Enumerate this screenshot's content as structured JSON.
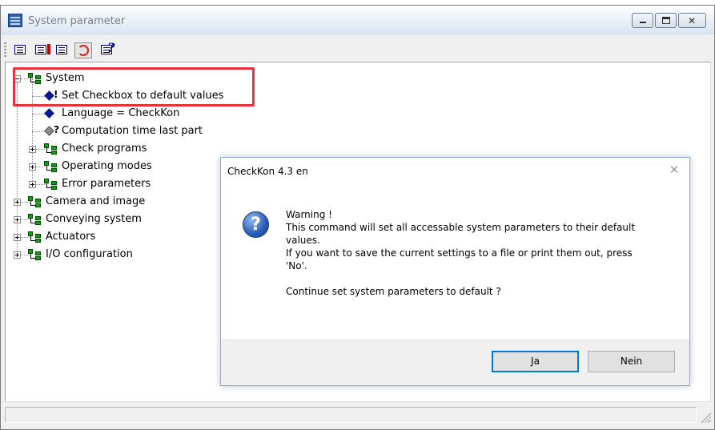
{
  "window": {
    "title": "System parameter",
    "icon": "app-grid-icon"
  },
  "toolbar": {
    "buttons": [
      {
        "name": "expand-all-icon"
      },
      {
        "name": "collapse-all-icon"
      },
      {
        "name": "find-icon"
      },
      {
        "name": "reset-default-icon",
        "pressed": true
      },
      {
        "name": "help-icon"
      }
    ]
  },
  "tree": {
    "nodes": [
      {
        "label": "System",
        "type": "folder",
        "expanded": true
      },
      {
        "label": "Set Checkbox to default values",
        "type": "param",
        "mark": "!"
      },
      {
        "label": "Language = CheckKon",
        "type": "param",
        "mark": ""
      },
      {
        "label": "Computation time last part",
        "type": "param-gray",
        "mark": "?"
      },
      {
        "label": "Check programs",
        "type": "folder",
        "expanded": false
      },
      {
        "label": "Operating modes",
        "type": "folder",
        "expanded": false
      },
      {
        "label": "Error parameters",
        "type": "folder",
        "expanded": false
      },
      {
        "label": "Camera and image",
        "type": "folder",
        "expanded": false
      },
      {
        "label": "Conveying system",
        "type": "folder",
        "expanded": false
      },
      {
        "label": "Actuators",
        "type": "folder",
        "expanded": false
      },
      {
        "label": "I/O configuration",
        "type": "folder",
        "expanded": false
      }
    ]
  },
  "dialog": {
    "title": "CheckKon 4.3 en",
    "close_glyph": "✕",
    "icon_glyph": "?",
    "message": {
      "line1": "Warning !",
      "line2": "This command will set all accessable system parameters to their default",
      "line3": "values.",
      "line4": "If you want to save the current settings to a file or print them out, press",
      "line5": "'No'.",
      "line6": "Continue set system parameters to default ?"
    },
    "buttons": {
      "yes": "Ja",
      "no": "Nein"
    }
  },
  "colors": {
    "highlight": "#e8323c",
    "default_button_border": "#0078d7",
    "tree_folder": "#00aa00",
    "tree_param": "#0a1a8a"
  }
}
